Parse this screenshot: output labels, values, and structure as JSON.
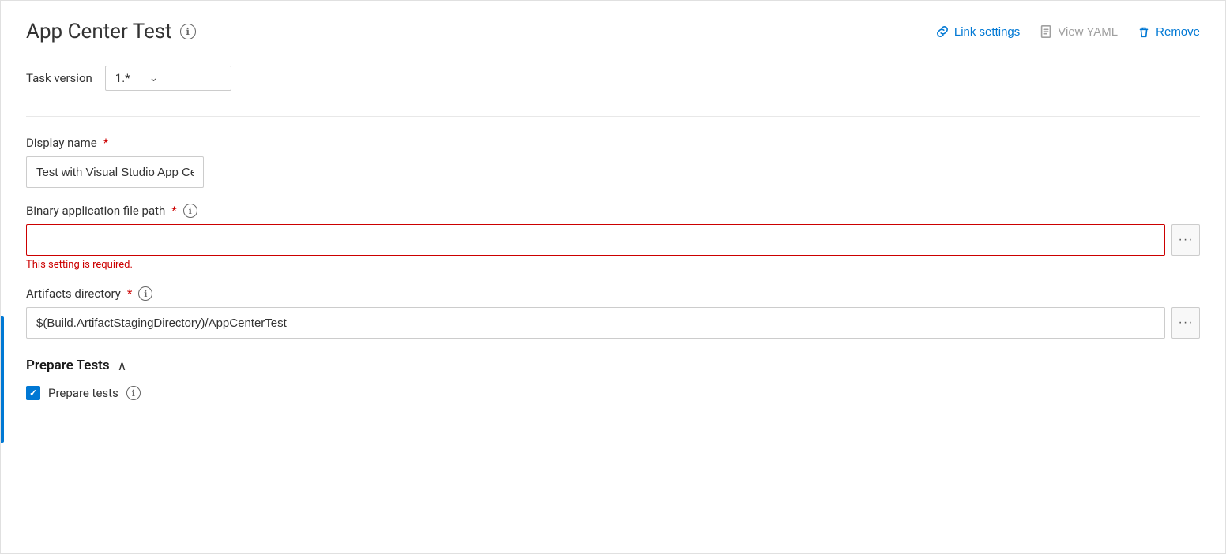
{
  "header": {
    "title": "App Center Test",
    "actions": {
      "link_settings": "Link settings",
      "view_yaml": "View YAML",
      "remove": "Remove"
    }
  },
  "task_version": {
    "label": "Task version",
    "value": "1.*"
  },
  "display_name": {
    "label": "Display name",
    "required": true,
    "value": "Test with Visual Studio App Center"
  },
  "binary_file_path": {
    "label": "Binary application file path",
    "required": true,
    "value": "",
    "error_message": "This setting is required."
  },
  "artifacts_directory": {
    "label": "Artifacts directory",
    "required": true,
    "value": "$(Build.ArtifactStagingDirectory)/AppCenterTest"
  },
  "prepare_tests": {
    "section_title": "Prepare Tests",
    "checkbox_label": "Prepare tests",
    "checked": true
  },
  "icons": {
    "info": "ℹ",
    "ellipsis": "···",
    "chevron_down": "∨",
    "link": "🔗",
    "yaml": "📋",
    "trash": "🗑",
    "checkmark": "✓",
    "chevron_up": "∧"
  },
  "colors": {
    "blue": "#0078d4",
    "red": "#c00000",
    "border_error": "#c00000",
    "left_bar": "#0078d4"
  }
}
